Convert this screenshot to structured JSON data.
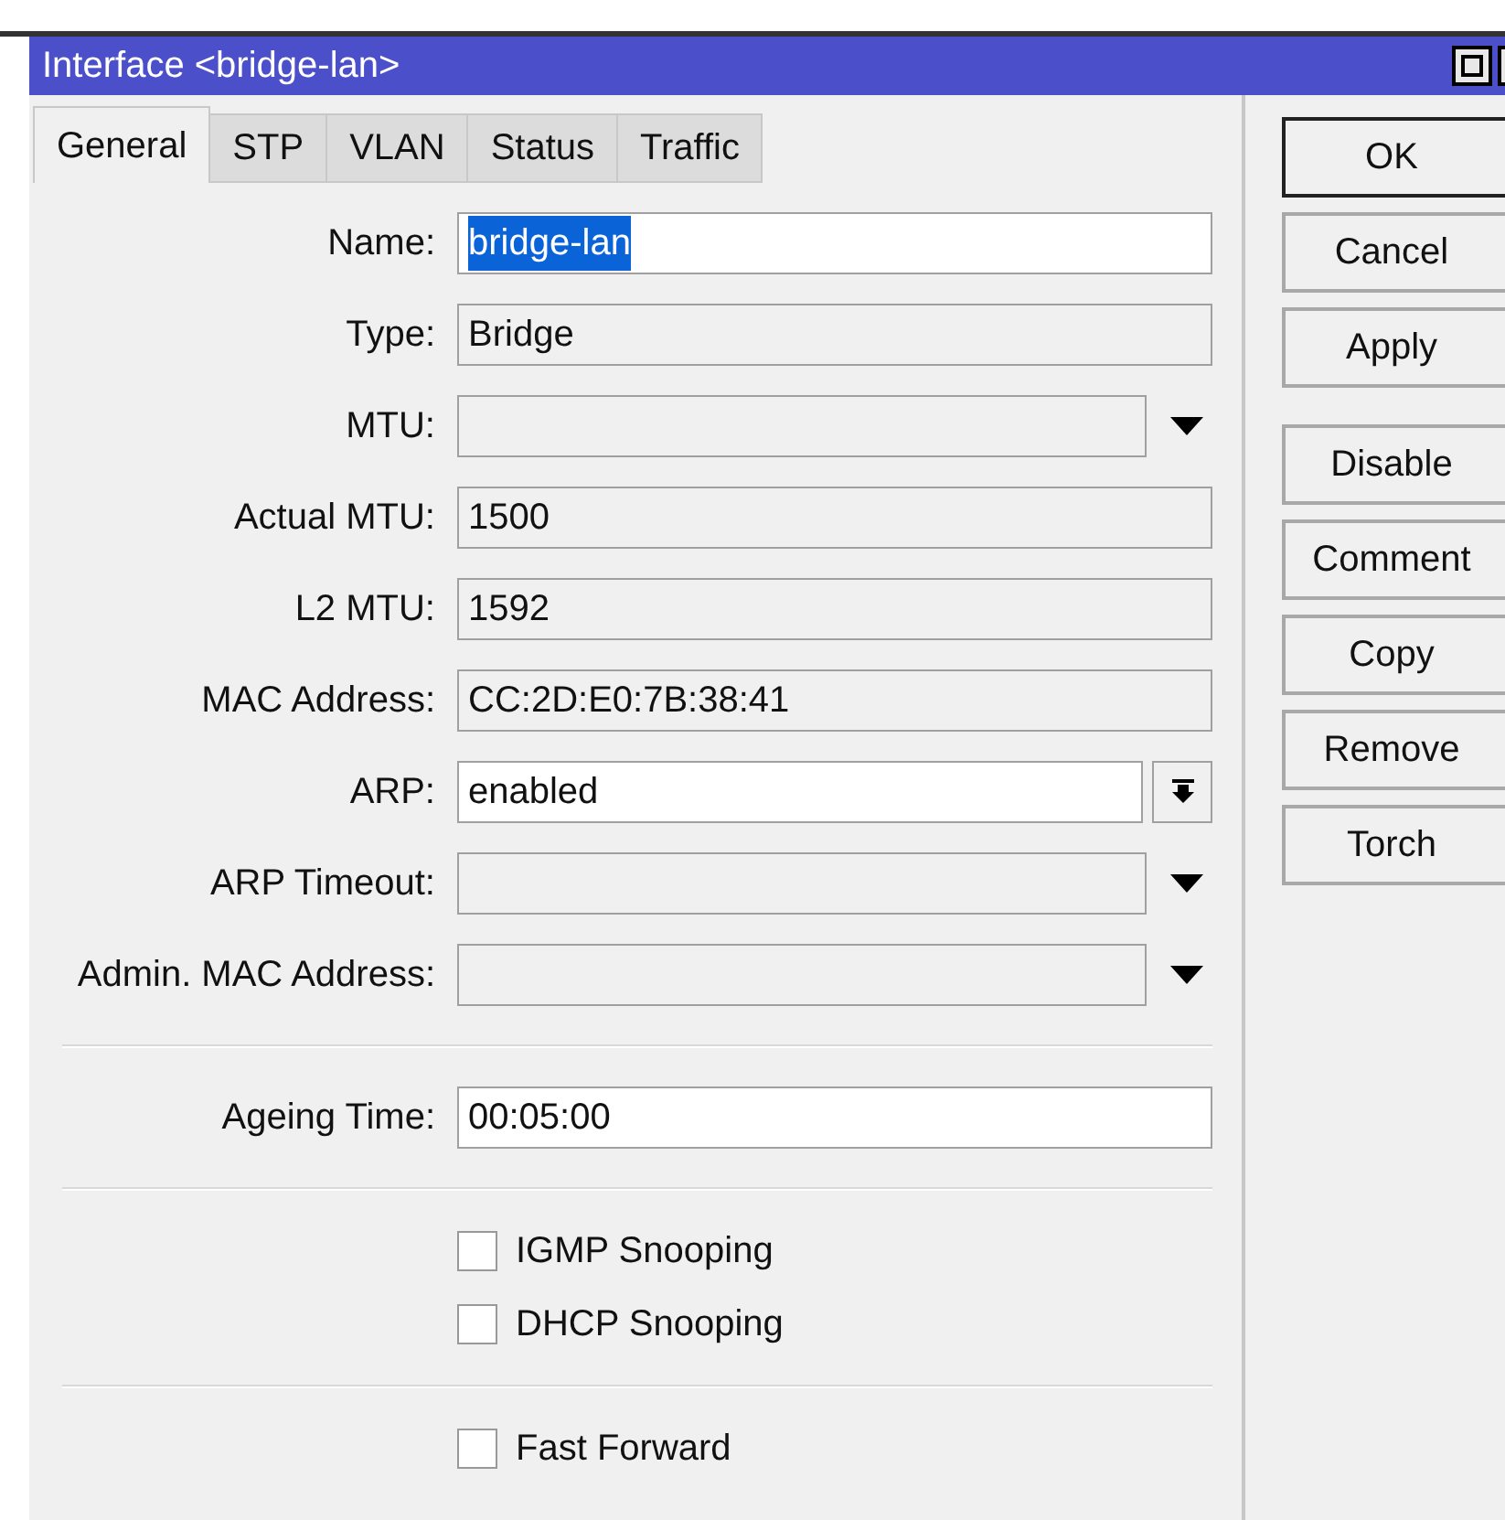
{
  "window": {
    "title": "Interface <bridge-lan>"
  },
  "tabs": [
    {
      "label": "General",
      "selected": true
    },
    {
      "label": "STP",
      "selected": false
    },
    {
      "label": "VLAN",
      "selected": false
    },
    {
      "label": "Status",
      "selected": false
    },
    {
      "label": "Traffic",
      "selected": false
    }
  ],
  "form": [
    {
      "kind": "text",
      "label": "Name:",
      "value": "bridge-lan",
      "text_selected": true
    },
    {
      "kind": "readonly",
      "label": "Type:",
      "value": "Bridge"
    },
    {
      "kind": "combo",
      "label": "MTU:"
    },
    {
      "kind": "readonly",
      "label": "Actual MTU:",
      "value": "1500"
    },
    {
      "kind": "readonly",
      "label": "L2 MTU:",
      "value": "1592"
    },
    {
      "kind": "readonly",
      "label": "MAC Address:",
      "value": "CC:2D:E0:7B:38:41"
    },
    {
      "kind": "select",
      "label": "ARP:",
      "value": "enabled"
    },
    {
      "kind": "combo",
      "label": "ARP Timeout:"
    },
    {
      "kind": "combo",
      "label": "Admin. MAC Address:"
    },
    {
      "kind": "divider"
    },
    {
      "kind": "text",
      "label": "Ageing Time:",
      "value": "00:05:00",
      "text_selected": false
    },
    {
      "kind": "divider"
    },
    {
      "kind": "checkbox",
      "label": "IGMP Snooping",
      "checked": false
    },
    {
      "kind": "checkbox",
      "label": "DHCP Snooping",
      "checked": false
    },
    {
      "kind": "divider"
    },
    {
      "kind": "checkbox",
      "label": "Fast Forward",
      "checked": false
    }
  ],
  "button_groups": [
    [
      {
        "label": "OK",
        "default": true
      },
      {
        "label": "Cancel",
        "default": false
      },
      {
        "label": "Apply",
        "default": false
      }
    ],
    [
      {
        "label": "Disable",
        "default": false
      },
      {
        "label": "Comment",
        "default": false
      },
      {
        "label": "Copy",
        "default": false
      },
      {
        "label": "Remove",
        "default": false
      },
      {
        "label": "Torch",
        "default": false
      }
    ]
  ]
}
